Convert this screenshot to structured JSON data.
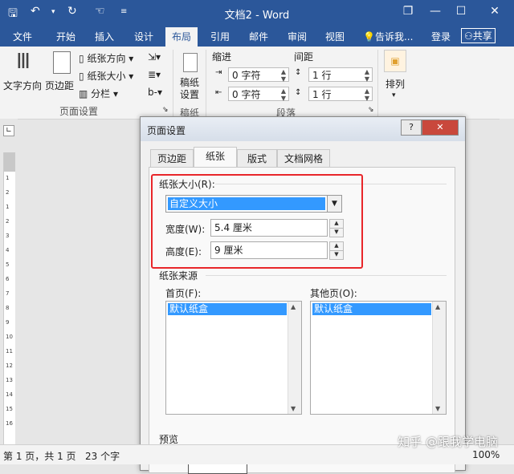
{
  "window": {
    "title": "文档2 - Word",
    "controls": {
      "restore": "❐",
      "minimize": "—",
      "maximize": "☐",
      "close": "✕"
    }
  },
  "tabs": [
    "文件",
    "开始",
    "插入",
    "设计",
    "布局",
    "引用",
    "邮件",
    "审阅",
    "视图"
  ],
  "active_tab": "布局",
  "tellme": "告诉我...",
  "login": "登录",
  "share": "共享",
  "ribbon": {
    "text_direction": "文字方向",
    "margins": "页边距",
    "orientation": "纸张方向",
    "size": "纸张大小",
    "columns": "分栏",
    "page_setup_group": "页面设置",
    "draft_paper": "稿纸\n设置",
    "draft_group": "稿纸",
    "indent": "缩进",
    "spacing": "间距",
    "indent_left": "0 字符",
    "indent_right": "0 字符",
    "spacing_before": "1 行",
    "spacing_after": "1 行",
    "paragraph_group": "段落",
    "arrange": "排列"
  },
  "ruler_numbers": [
    "1",
    "2",
    "1",
    "2",
    "3",
    "4",
    "5",
    "6",
    "7",
    "8",
    "9",
    "10",
    "11",
    "12",
    "13",
    "14",
    "15",
    "16"
  ],
  "dialog": {
    "title": "页面设置",
    "help": "?",
    "close": "✕",
    "tabs": [
      "页边距",
      "纸张",
      "版式",
      "文档网格"
    ],
    "active_tab": "纸张",
    "paper_size_label": "纸张大小(R):",
    "paper_size_value": "自定义大小",
    "width_label": "宽度(W):",
    "width_value": "5.4 厘米",
    "height_label": "高度(E):",
    "height_value": "9 厘米",
    "paper_source_label": "纸张来源",
    "first_page_label": "首页(F):",
    "first_page_value": "默认纸盒",
    "other_pages_label": "其他页(O):",
    "other_pages_value": "默认纸盒",
    "preview_label": "预览"
  },
  "status": {
    "page": "第 1 页，共 1 页",
    "words": "23 个字",
    "zoom": "100%"
  },
  "watermark": "知乎 @跟我学电脑",
  "colors": {
    "accent": "#2b579a",
    "highlight": "#3399ff",
    "annotation": "#e8262a"
  }
}
